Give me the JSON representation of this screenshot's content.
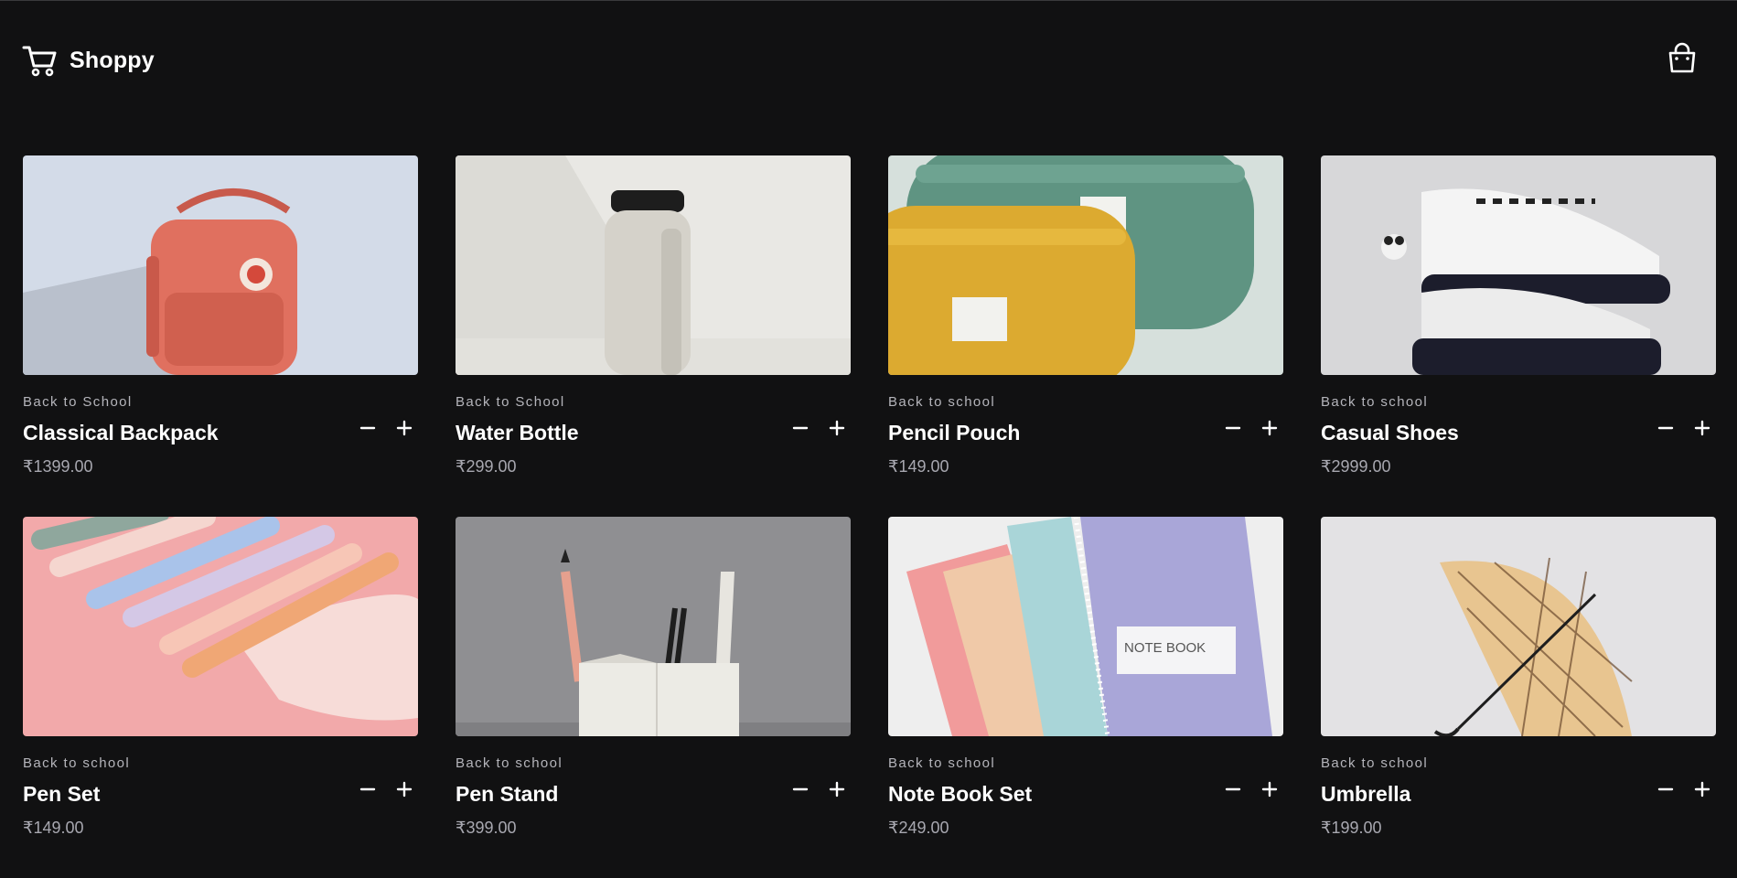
{
  "header": {
    "brand_name": "Shoppy",
    "brand_icon": "cart-icon",
    "cart_icon": "shopping-bag-icon"
  },
  "colors": {
    "background": "#111112",
    "text": "#ffffff",
    "muted": "#a8a8b0"
  },
  "products": [
    {
      "category": "Back to School",
      "title": "Classical Backpack",
      "price": "₹1399.00",
      "image": "orange-backpack"
    },
    {
      "category": "Back to School",
      "title": "Water Bottle",
      "price": "₹299.00",
      "image": "beige-water-bottle"
    },
    {
      "category": "Back to school",
      "title": "Pencil Pouch",
      "price": "₹149.00",
      "image": "green-and-yellow-pouches"
    },
    {
      "category": "Back to school",
      "title": "Casual Shoes",
      "price": "₹2999.00",
      "image": "white-panda-sneakers"
    },
    {
      "category": "Back to school",
      "title": "Pen Set",
      "price": "₹149.00",
      "image": "pastel-pens"
    },
    {
      "category": "Back to school",
      "title": "Pen Stand",
      "price": "₹399.00",
      "image": "white-pen-stand"
    },
    {
      "category": "Back to school",
      "title": "Note Book Set",
      "price": "₹249.00",
      "image": "spiral-notebooks"
    },
    {
      "category": "Back to school",
      "title": "Umbrella",
      "price": "₹199.00",
      "image": "plaid-umbrella"
    }
  ],
  "icons": {
    "minus": "minus-icon",
    "plus": "plus-icon"
  },
  "image_text": {
    "notebook_label": "NOTE BOOK"
  }
}
